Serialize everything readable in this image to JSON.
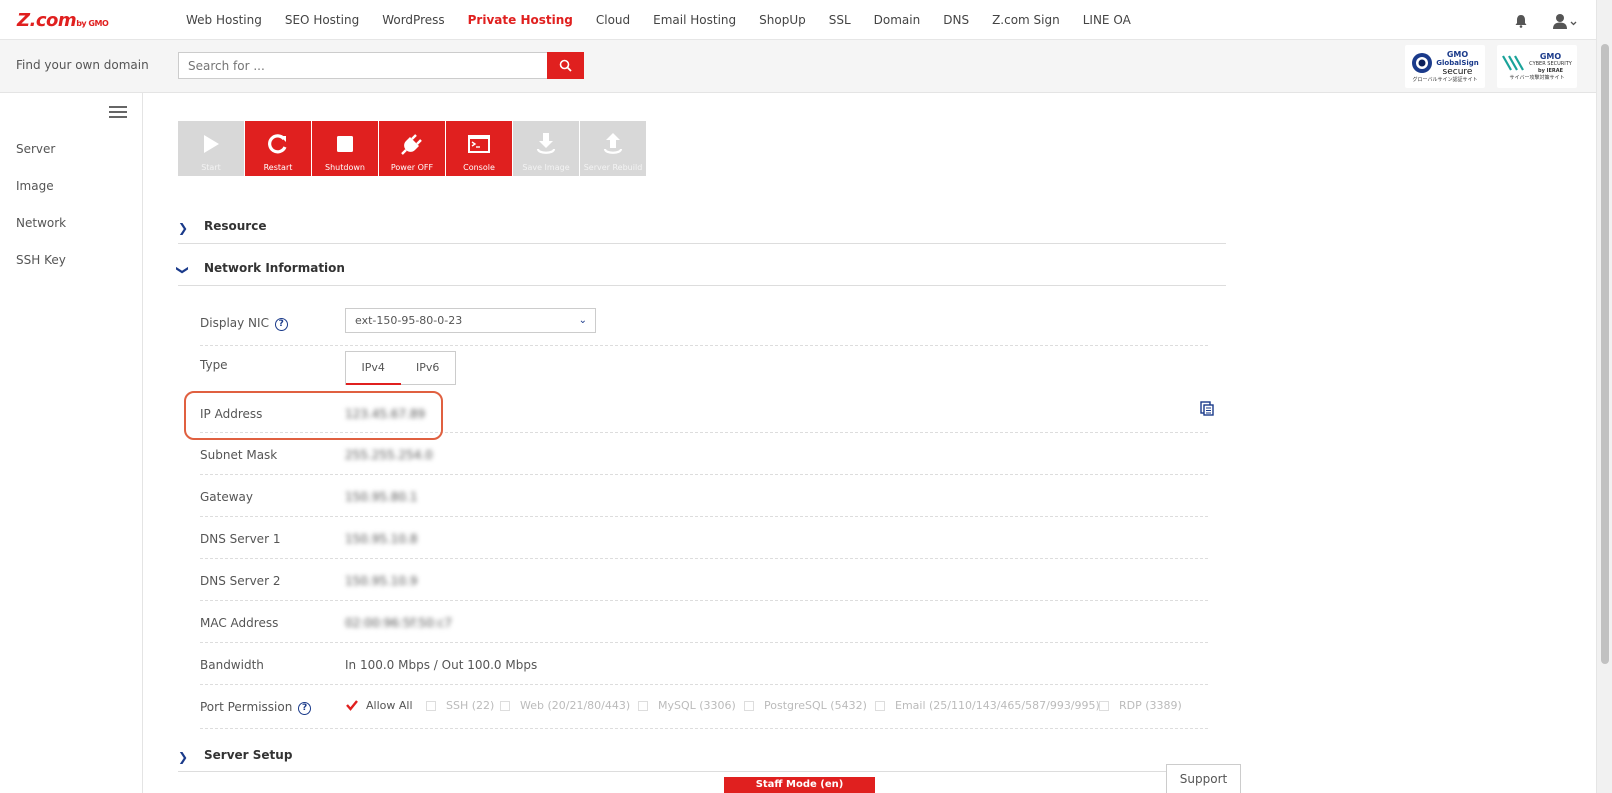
{
  "header": {
    "logo_main": "Z.com",
    "logo_sub": "by GMO",
    "nav": [
      "Web Hosting",
      "SEO Hosting",
      "WordPress",
      "Private Hosting",
      "Cloud",
      "Email Hosting",
      "ShopUp",
      "SSL",
      "Domain",
      "DNS",
      "Z.com Sign",
      "LINE OA"
    ],
    "active_nav": "Private Hosting"
  },
  "search": {
    "label": "Find your own domain",
    "placeholder": "Search for ..."
  },
  "badges": {
    "globalsign_title": "GMO",
    "globalsign_name": "GlobalSign",
    "globalsign_word": "secure",
    "globalsign_jp": "グローバルサイン認証サイト",
    "security_title": "GMO",
    "security_name": "CYBER SECURITY",
    "security_by": "by IERAE",
    "security_jp": "サイバー攻撃対策サイト"
  },
  "sidebar": {
    "items": [
      "Server",
      "Image",
      "Network",
      "SSH Key"
    ]
  },
  "toolbar": {
    "buttons": [
      {
        "label": "Start",
        "icon": "play-icon",
        "enabled": false
      },
      {
        "label": "Restart",
        "icon": "restart-icon",
        "enabled": true
      },
      {
        "label": "Shutdown",
        "icon": "stop-icon",
        "enabled": true
      },
      {
        "label": "Power OFF",
        "icon": "plug-icon",
        "enabled": true
      },
      {
        "label": "Console",
        "icon": "console-icon",
        "enabled": true
      },
      {
        "label": "Save Image",
        "icon": "save-image-icon",
        "enabled": false
      },
      {
        "label": "Server Rebuild",
        "icon": "rebuild-icon",
        "enabled": false
      }
    ]
  },
  "sections": {
    "resource": "Resource",
    "network": "Network Information",
    "setup": "Server Setup"
  },
  "network": {
    "display_nic_label": "Display NIC",
    "display_nic_value": "ext-150-95-80-0-23",
    "type_label": "Type",
    "type_options": [
      "IPv4",
      "IPv6"
    ],
    "type_selected": "IPv4",
    "ip_label": "IP Address",
    "ip_value": "123.45.67.89",
    "subnet_label": "Subnet Mask",
    "subnet_value": "255.255.254.0",
    "gateway_label": "Gateway",
    "gateway_value": "150.95.80.1",
    "dns1_label": "DNS Server 1",
    "dns1_value": "150.95.10.8",
    "dns2_label": "DNS Server 2",
    "dns2_value": "150.95.10.9",
    "mac_label": "MAC Address",
    "mac_value": "02:00:96:5f:50:c7",
    "bandwidth_label": "Bandwidth",
    "bandwidth_value": "In 100.0 Mbps / Out 100.0 Mbps",
    "port_label": "Port Permission",
    "ports": [
      {
        "label": "Allow All",
        "checked": true
      },
      {
        "label": "SSH (22)",
        "checked": false
      },
      {
        "label": "Web (20/21/80/443)",
        "checked": false
      },
      {
        "label": "MySQL (3306)",
        "checked": false
      },
      {
        "label": "PostgreSQL (5432)",
        "checked": false
      },
      {
        "label": "Email (25/110/143/465/587/993/995)",
        "checked": false
      },
      {
        "label": "RDP (3389)",
        "checked": false
      }
    ]
  },
  "footer": {
    "staff_mode": "Staff Mode (en)",
    "support": "Support"
  },
  "colors": {
    "brand_red": "#e0201f",
    "accent_navy": "#1a3a8a",
    "highlight": "#e06040"
  }
}
